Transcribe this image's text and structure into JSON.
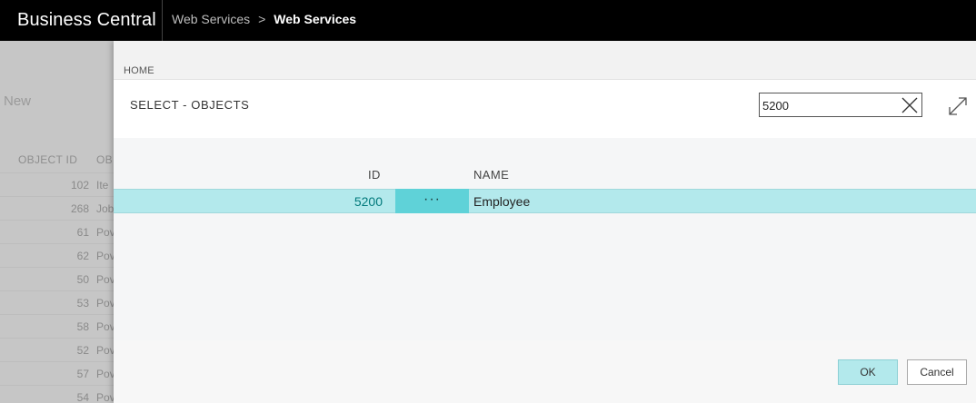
{
  "app": {
    "title": "Business Central",
    "breadcrumb": [
      "Web Services",
      "Web Services"
    ],
    "breadcrumb_separator": ">"
  },
  "background_page": {
    "action_new": "New",
    "columns": [
      "OBJECT ID",
      "OB"
    ],
    "rows": [
      {
        "id": "102",
        "name": "Ite"
      },
      {
        "id": "268",
        "name": "Job"
      },
      {
        "id": "61",
        "name": "Pov"
      },
      {
        "id": "62",
        "name": "Pov"
      },
      {
        "id": "50",
        "name": "Pov"
      },
      {
        "id": "53",
        "name": "Pov"
      },
      {
        "id": "58",
        "name": "Pov"
      },
      {
        "id": "52",
        "name": "Pov"
      },
      {
        "id": "57",
        "name": "Pov"
      },
      {
        "id": "54",
        "name": "Pov"
      }
    ]
  },
  "dialog": {
    "tab": "HOME",
    "title": "SELECT - OBJECTS",
    "search": {
      "value": "5200",
      "placeholder": ""
    },
    "columns": {
      "id": "ID",
      "name": "NAME"
    },
    "rows": [
      {
        "id": "5200",
        "actions": "···",
        "name": "Employee",
        "selected": true
      }
    ],
    "buttons": {
      "ok": "OK",
      "cancel": "Cancel"
    }
  },
  "colors": {
    "topbar": "#000000",
    "selection": "#b3e9ec",
    "row_actions": "#5fd2d8",
    "id_link": "#00797b"
  },
  "icons": {
    "search_clear": "close-icon",
    "expand": "expand-icon"
  }
}
